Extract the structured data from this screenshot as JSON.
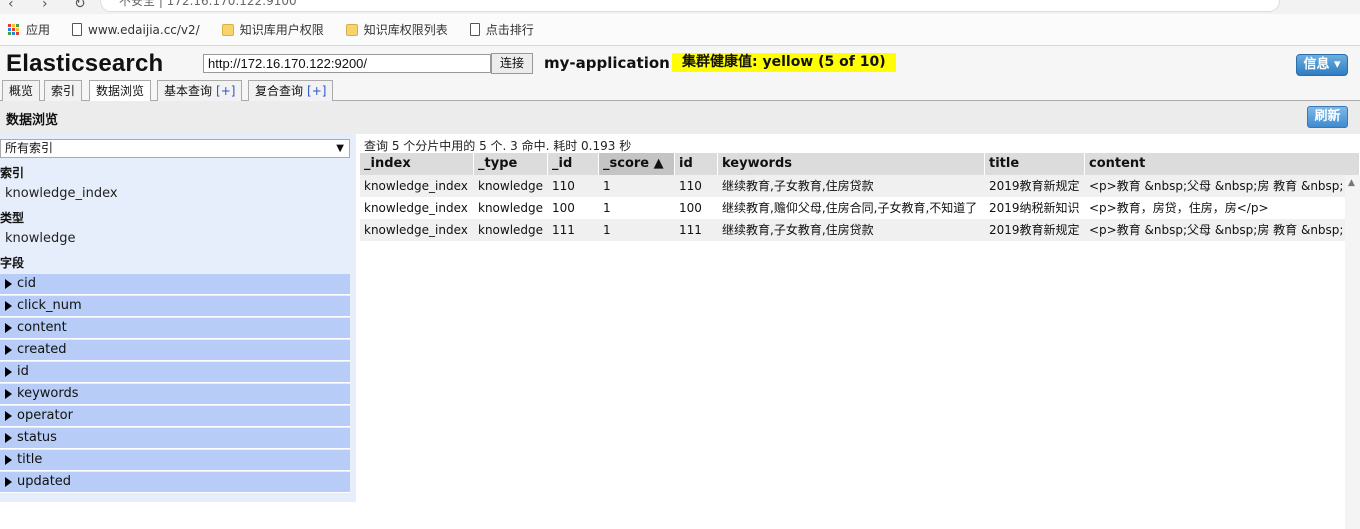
{
  "browser": {
    "address_text": "不安全 | 172.16.170.122:9100",
    "bookmarks": [
      {
        "label": "应用",
        "icon": "apps-icon"
      },
      {
        "label": "www.edaijia.cc/v2/",
        "icon": "page-icon"
      },
      {
        "label": "知识库用户权限",
        "icon": "folder-icon"
      },
      {
        "label": "知识库权限列表",
        "icon": "folder-icon"
      },
      {
        "label": "点击排行",
        "icon": "page-icon"
      }
    ]
  },
  "header": {
    "app_title": "Elasticsearch",
    "url_value": "http://172.16.170.122:9200/",
    "connect_label": "连接",
    "cluster_name": "my-application",
    "health_text": "集群健康值: yellow (5 of 10)",
    "health_color": "#ffff00",
    "info_label": "信息 ▾"
  },
  "tabs": [
    {
      "label": "概览",
      "plus": ""
    },
    {
      "label": "索引",
      "plus": ""
    },
    {
      "label": "数据浏览",
      "plus": ""
    },
    {
      "label": "基本查询",
      "plus": "[+]"
    },
    {
      "label": "复合查询",
      "plus": "[+]"
    }
  ],
  "section": {
    "title": "数据浏览",
    "refresh_label": "刷新"
  },
  "sidebar": {
    "index_select_value": "所有索引",
    "index_heading": "索引",
    "index_value": "knowledge_index",
    "type_heading": "类型",
    "type_value": "knowledge",
    "fields_heading": "字段",
    "fields": [
      "cid",
      "click_num",
      "content",
      "created",
      "id",
      "keywords",
      "operator",
      "status",
      "title",
      "updated"
    ]
  },
  "results": {
    "summary": "查询 5 个分片中用的 5 个. 3 命中. 耗时 0.193 秒",
    "columns": [
      "_index",
      "_type",
      "_id",
      "_score ▲",
      "id",
      "keywords",
      "title",
      "content"
    ],
    "rows": [
      [
        "knowledge_index",
        "knowledge",
        "110",
        "1",
        "110",
        "继续教育,子女教育,住房贷款",
        "2019教育新规定",
        "<p>教育 &nbsp;父母 &nbsp;房 教育 &nbsp;"
      ],
      [
        "knowledge_index",
        "knowledge",
        "100",
        "1",
        "100",
        "继续教育,赡仰父母,住房合同,子女教育,不知道了",
        "2019纳税新知识",
        "<p>教育，房贷，住房，房</p>"
      ],
      [
        "knowledge_index",
        "knowledge",
        "111",
        "1",
        "111",
        "继续教育,子女教育,住房贷款",
        "2019教育新规定",
        "<p>教育 &nbsp;父母 &nbsp;房 教育 &nbsp;"
      ]
    ]
  },
  "colors": {
    "accent": "#3a87c5",
    "field_row_bg": "#b7cdf7",
    "sidebar_bg": "#e6eefb"
  }
}
